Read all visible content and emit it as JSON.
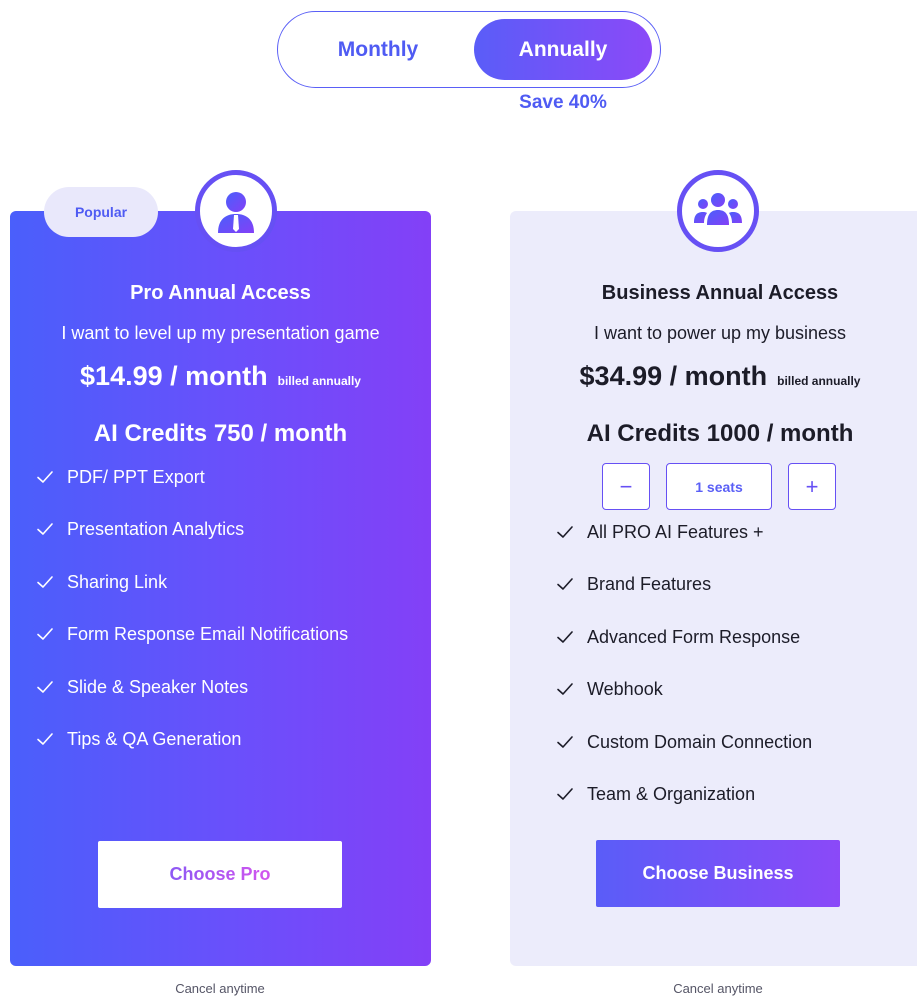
{
  "billing_toggle": {
    "monthly_label": "Monthly",
    "annually_label": "Annually",
    "selected": "Annually",
    "save_label": "Save 40%"
  },
  "plans": {
    "pro": {
      "badge": "Popular",
      "title": "Pro Annual Access",
      "subtitle": "I want to level up my presentation game",
      "price": "$14.99 / month",
      "billing_note": "billed annually",
      "credits": "AI Credits 750 / month",
      "features": [
        "PDF/ PPT Export",
        "Presentation Analytics",
        "Sharing Link",
        "Form Response Email Notifications",
        "Slide & Speaker Notes",
        "Tips & QA Generation"
      ],
      "cta_label": "Choose Pro",
      "cancel_note": "Cancel anytime",
      "icon": "user-icon"
    },
    "business": {
      "title": "Business Annual Access",
      "subtitle": "I want to power up my business",
      "price": "$34.99 / month",
      "billing_note": "billed annually",
      "credits": "AI Credits 1000 / month",
      "seats": {
        "decrement_label": "−",
        "value": "1 seats",
        "increment_label": "+"
      },
      "features": [
        "All PRO AI Features +",
        "Brand Features",
        "Advanced Form Response",
        "Webhook",
        "Custom Domain Connection",
        "Team & Organization"
      ],
      "cta_label": "Choose Business",
      "cancel_note": "Cancel anytime",
      "icon": "team-icon"
    }
  },
  "colors": {
    "accent": "#5a5ff6",
    "gradient_start": "#4a5ffb",
    "gradient_end": "#8340f7",
    "business_card_bg": "#ececfb"
  }
}
